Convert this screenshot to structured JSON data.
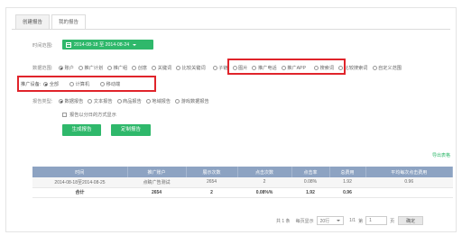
{
  "tabs": [
    "创建报告",
    "我的报告"
  ],
  "time_range": {
    "label": "时间范围:",
    "value": "2014-08-18 至 2014-08-24"
  },
  "data_scope": {
    "label": "数据范围:",
    "options": [
      "账户",
      "推广计划",
      "推广组",
      "创意",
      "关键词",
      "比较关键词",
      "子链",
      "图片",
      "推广电话",
      "推广APP",
      "搜索词",
      "比较搜索词",
      "自定义范围"
    ]
  },
  "device": {
    "label": "推广设备:",
    "options": [
      "全部",
      "计算机",
      "移动端"
    ]
  },
  "report_type": {
    "label": "报告类型:",
    "options": [
      "数据报告",
      "文本报告",
      "商品报告",
      "地域报告",
      "游戏数据报告"
    ]
  },
  "split_checkbox": "报告以分日的方式显示",
  "buttons": {
    "generate": "生成报告",
    "schedule": "定制报告"
  },
  "export_label": "导出表格",
  "table": {
    "headers": [
      "时间",
      "推广账户",
      "展示次数",
      "点击次数",
      "点击率",
      "总费用",
      "平均每次点击费用"
    ],
    "rows": [
      [
        "2014-08-18至2014-08-25",
        "点睛广告测试",
        "2654",
        "2",
        "0.08%",
        "1.92",
        "0.96"
      ]
    ],
    "total": [
      "合计",
      "2654",
      "2",
      "0.08%%",
      "1.92",
      "0.96",
      ""
    ]
  },
  "pager": {
    "total_text": "共 1 条",
    "per_page_label": "每页显示",
    "per_page_value": "20行",
    "page_text": "1/1",
    "goto_label": "第",
    "goto_value": "1",
    "page_unit": "页",
    "confirm_label": "确定"
  }
}
